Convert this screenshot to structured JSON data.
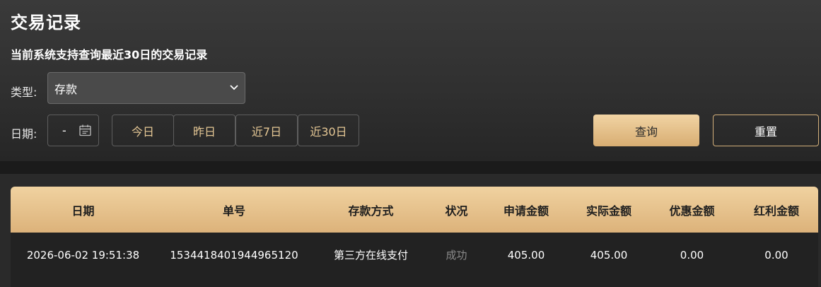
{
  "page": {
    "title": "交易记录",
    "subtitle": "当前系统支持查询最近30日的交易记录"
  },
  "filters": {
    "type_label": "类型:",
    "type_value": "存款",
    "date_label": "日期:",
    "date_separator": "-",
    "quick_ranges": [
      "今日",
      "昨日",
      "近7日",
      "近30日"
    ],
    "query_label": "查询",
    "reset_label": "重置"
  },
  "icons": {
    "select_arrow": "chevron-down-icon",
    "date_picker": "calendar-icon"
  },
  "colors": {
    "accent_gold": "#dcb27a",
    "accent_gold_light": "#f0d2a0",
    "quick_text": "#e6c895",
    "status_muted": "#8a8a8a"
  },
  "table": {
    "headers": [
      "日期",
      "单号",
      "存款方式",
      "状况",
      "申请金额",
      "实际金额",
      "优惠金额",
      "红利金额"
    ],
    "rows": [
      [
        "2026-06-02 19:51:38",
        "1534418401944965120",
        "第三方在线支付",
        "成功",
        "405.00",
        "405.00",
        "0.00",
        "0.00"
      ]
    ]
  }
}
